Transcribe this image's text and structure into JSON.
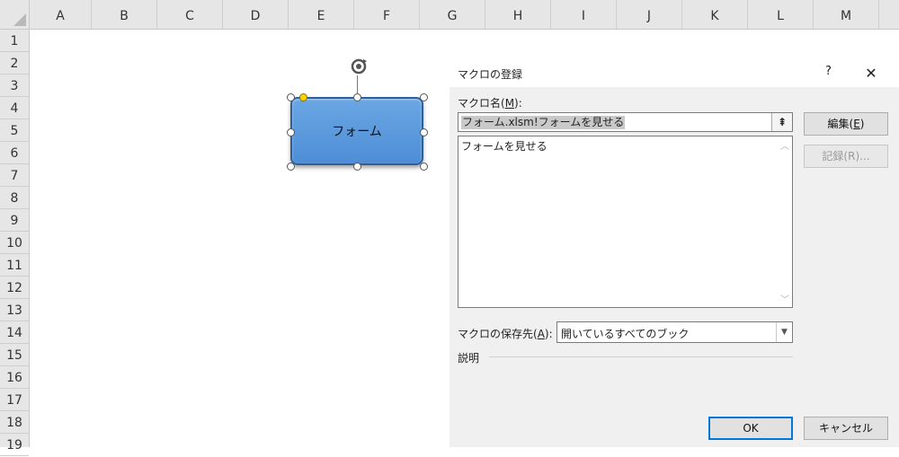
{
  "spreadsheet": {
    "columns": [
      "A",
      "B",
      "C",
      "D",
      "E",
      "F",
      "G",
      "H",
      "I",
      "J",
      "K",
      "L",
      "M"
    ],
    "rows": [
      "1",
      "2",
      "3",
      "4",
      "5",
      "6",
      "7",
      "8",
      "9",
      "10",
      "11",
      "12",
      "13",
      "14",
      "15",
      "16",
      "17",
      "18",
      "19"
    ]
  },
  "shape": {
    "label": "フォーム"
  },
  "dialog": {
    "title": "マクロの登録",
    "help": "?",
    "close": "✕",
    "macro_name_label_pre": "マクロ名(",
    "macro_name_label_key": "M",
    "macro_name_label_post": "):",
    "macro_name_value": "フォーム.xlsm!フォームを見せる",
    "collapse_icon": "⇞",
    "list_items": [
      "フォームを見せる"
    ],
    "edit_button": "編集(E)",
    "edit_pre": "編集(",
    "edit_key": "E",
    "edit_post": ")",
    "record_button": "記録(R)...",
    "store_label_pre": "マクロの保存先(",
    "store_label_key": "A",
    "store_label_post": "):",
    "store_value": "開いているすべてのブック",
    "description_label": "説明",
    "ok_button": "OK",
    "cancel_button": "キャンセル"
  },
  "colors": {
    "shape_fill": "#5b9bd5",
    "accent": "#0078d7"
  }
}
